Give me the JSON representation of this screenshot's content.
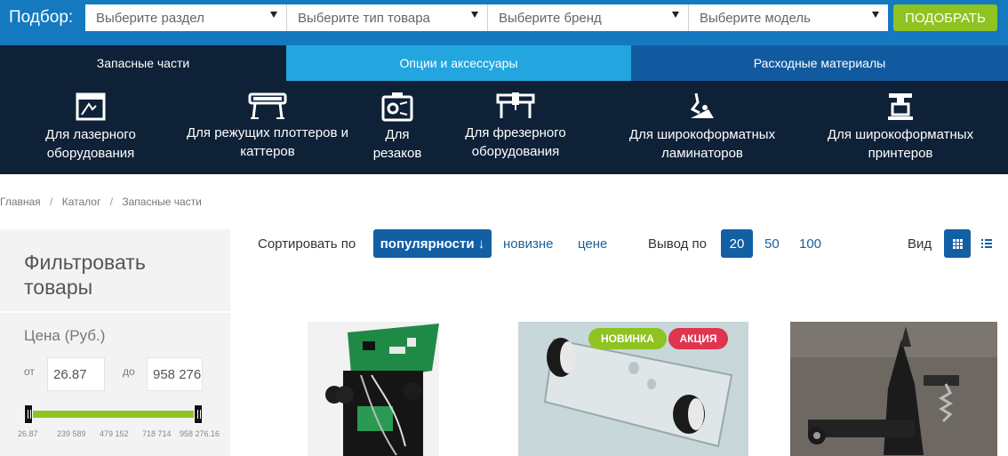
{
  "selector_bar": {
    "label": "Подбор:",
    "selects": [
      "Выберите раздел",
      "Выберите тип товара",
      "Выберите бренд",
      "Выберите модель"
    ],
    "submit_label": "ПОДОБРАТЬ",
    "bg_color": "#1479bf",
    "submit_color": "#8fc321"
  },
  "tabs": [
    {
      "label": "Запасные части",
      "active": false
    },
    {
      "label": "Опции и аксессуары",
      "active": true
    },
    {
      "label": "Расходные материалы",
      "active": false
    }
  ],
  "categories": [
    {
      "line1": "Для лазерного",
      "line2": "оборудования",
      "icon": "laser-machine-icon"
    },
    {
      "line1": "Для режущих плоттеров и",
      "line2": "каттеров",
      "icon": "plotter-icon"
    },
    {
      "line1": "Для",
      "line2": "резаков",
      "icon": "cutter-icon"
    },
    {
      "line1": "Для фрезерного",
      "line2": "оборудования",
      "icon": "milling-machine-icon"
    },
    {
      "line1": "Для широкоформатных",
      "line2": "ламинаторов",
      "icon": "laminator-icon"
    },
    {
      "line1": "Для широкоформатных",
      "line2": "принтеров",
      "icon": "wide-printer-icon"
    }
  ],
  "breadcrumb": [
    "Главная",
    "Каталог",
    "Запасные части"
  ],
  "filter": {
    "title_line1": "Фильтровать",
    "title_line2": "товары",
    "price_title": "Цена (Руб.)",
    "from_label": "от",
    "to_label": "до",
    "from_value": "26.87",
    "to_value": "958 276",
    "ticks": [
      "26.87",
      "239 589",
      "479 152",
      "718 714",
      "958 276.16"
    ],
    "range_selected": [
      0,
      1
    ]
  },
  "sort": {
    "label": "Сортировать по",
    "active": "популярности ↓",
    "options": [
      "новизне",
      "цене"
    ]
  },
  "output": {
    "label": "Вывод по",
    "active": "20",
    "options": [
      "50",
      "100"
    ]
  },
  "view": {
    "label": "Вид",
    "active": "grid"
  },
  "products": [
    {
      "image": "circuit-board-assembly",
      "badges": []
    },
    {
      "image": "roller-bracket",
      "badges": [
        "НОВИНКА",
        "АКЦИЯ"
      ]
    },
    {
      "image": "blade-holder-mechanism",
      "badges": []
    }
  ],
  "colors": {
    "dark_navy": "#0e2137",
    "active_tab": "#23a6df",
    "accent_blue": "#135fa4",
    "green": "#8fc321",
    "sale_red": "#e0344f"
  }
}
